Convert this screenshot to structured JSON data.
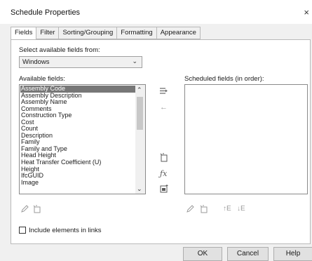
{
  "window": {
    "title": "Schedule Properties",
    "close_glyph": "×"
  },
  "tabs": [
    {
      "label": "Fields",
      "active": true
    },
    {
      "label": "Filter"
    },
    {
      "label": "Sorting/Grouping"
    },
    {
      "label": "Formatting"
    },
    {
      "label": "Appearance"
    }
  ],
  "fields": {
    "select_from_label": "Select available fields from:",
    "select_from_value": "Windows",
    "available_label": "Available fields:",
    "scheduled_label": "Scheduled fields (in order):",
    "available_items": [
      "Assembly Code",
      "Assembly Description",
      "Assembly Name",
      "Comments",
      "Construction Type",
      "Cost",
      "Count",
      "Description",
      "Family",
      "Family and Type",
      "Head Height",
      "Heat Transfer Coefficient (U)",
      "Height",
      "IfcGUID",
      "Image"
    ],
    "selected_index": 0,
    "include_links_label": "Include elements in links",
    "include_links_checked": false
  },
  "icons": {
    "add_param": "add-parameter-icon",
    "remove_param": "remove-parameter-icon",
    "new_param": "new-parameter-icon",
    "calculated": "calculated-value-icon",
    "combine": "combine-parameters-icon",
    "edit": "edit-icon",
    "delete": "delete-icon",
    "move_up": "move-up-icon",
    "move_down": "move-down-icon",
    "fx_glyph": "ƒx",
    "move_up_glyph": "↑E",
    "move_down_glyph": "↓E"
  },
  "buttons": {
    "ok": "OK",
    "cancel": "Cancel",
    "help": "Help"
  }
}
